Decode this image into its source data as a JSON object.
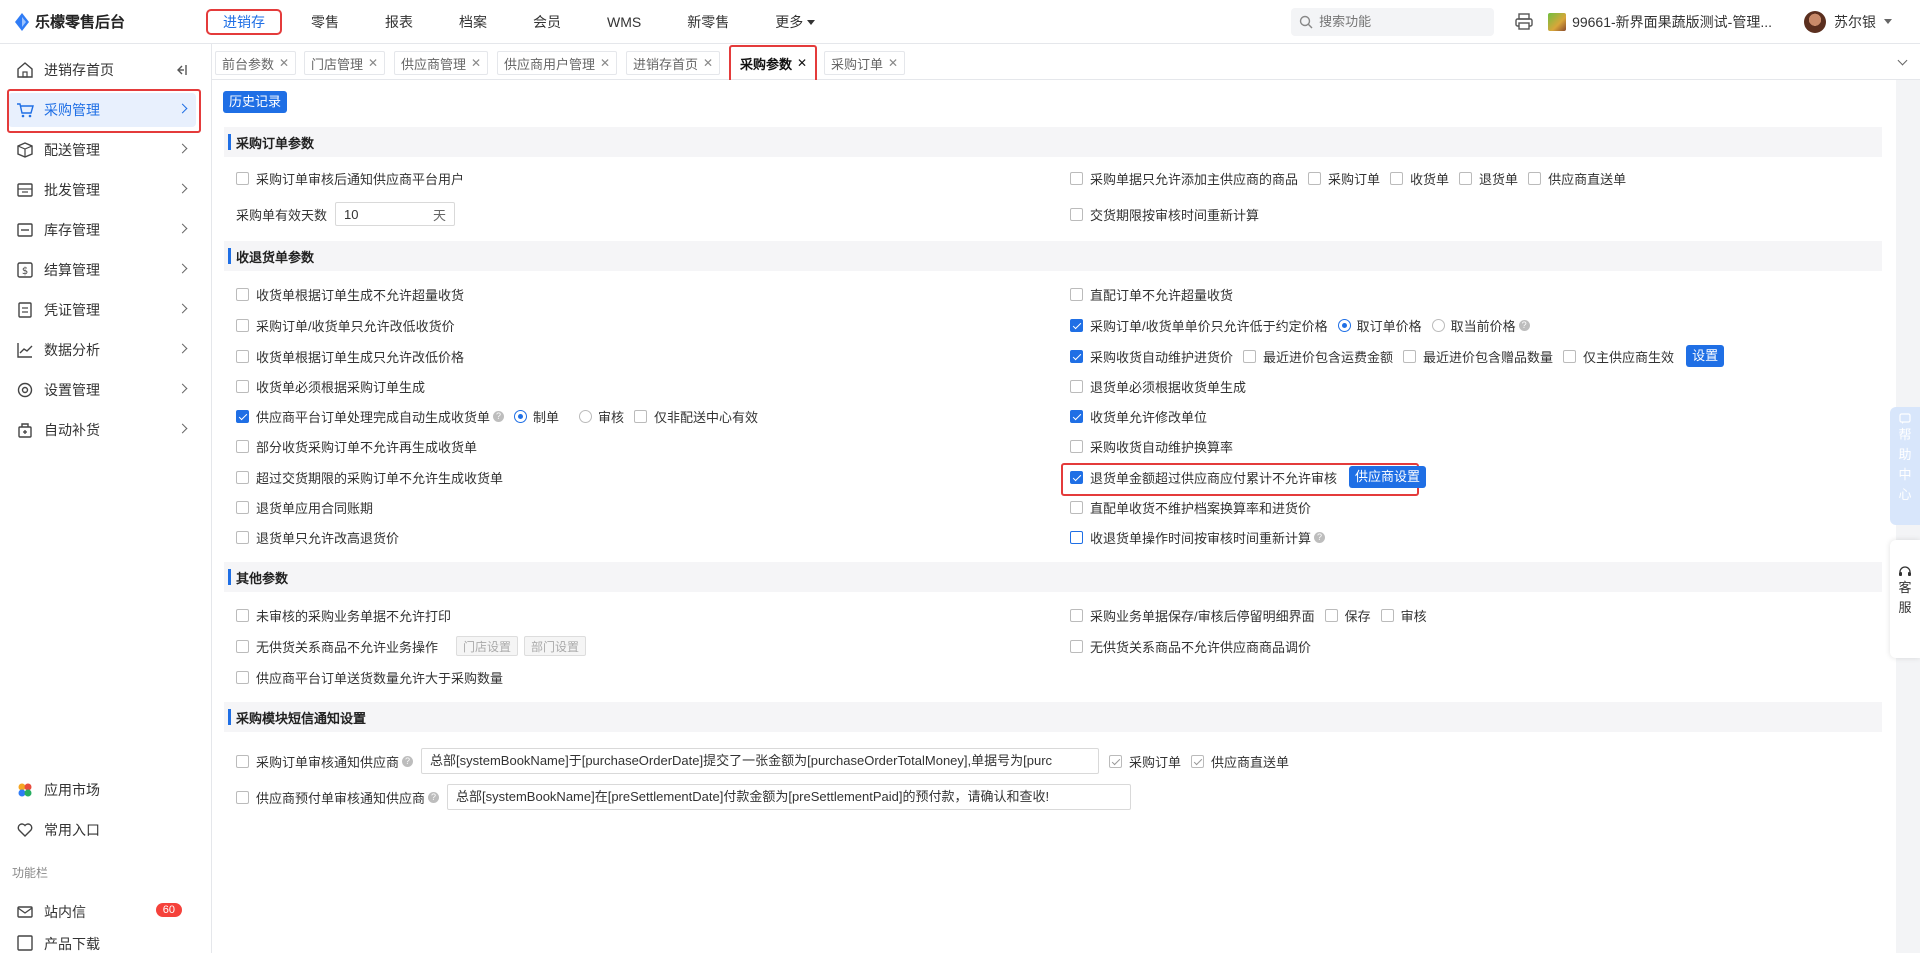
{
  "app": {
    "brand": "乐檬零售后台"
  },
  "topnav": {
    "items": [
      "进销存",
      "零售",
      "报表",
      "档案",
      "会员",
      "WMS",
      "新零售",
      "更多"
    ],
    "search_placeholder": "搜索功能",
    "store": "99661-新界面果蔬版测试-管理...",
    "user": "苏尔银"
  },
  "sidebar": {
    "items": [
      "进销存首页",
      "采购管理",
      "配送管理",
      "批发管理",
      "库存管理",
      "结算管理",
      "凭证管理",
      "数据分析",
      "设置管理",
      "自动补货"
    ],
    "bottom": {
      "market": "应用市场",
      "common": "常用入口",
      "group_label": "功能栏",
      "inbox": "站内信",
      "inbox_count": "60",
      "download": "产品下载"
    }
  },
  "tabs": [
    "前台参数",
    "门店管理",
    "供应商管理",
    "供应商用户管理",
    "进销存首页",
    "采购参数",
    "采购订单"
  ],
  "toolbar": {
    "history": "历史记录"
  },
  "sections": {
    "order": {
      "title": "采购订单参数",
      "notify_supplier": "采购订单审核后通知供应商平台用户",
      "valid_days_label": "采购单有效天数",
      "valid_days_value": "10",
      "valid_days_unit": "天",
      "main_supplier_only": "采购单据只允许添加主供应商的商品",
      "opt_order": "采购订单",
      "opt_receipt": "收货单",
      "opt_return": "退货单",
      "opt_direct": "供应商直送单",
      "recalc_delivery": "交货期限按审核时间重新计算"
    },
    "receipt": {
      "title": "收退货单参数",
      "left": [
        "收货单根据订单生成不允许超量收货",
        "采购订单/收货单只允许改低收货价",
        "收货单根据订单生成只允许改低价格",
        "收货单必须根据采购订单生成",
        "供应商平台订单处理完成自动生成收货单",
        "部分收货采购订单不允许再生成收货单",
        "超过交货期限的采购订单不允许生成收货单",
        "退货单应用合同账期",
        "退货单只允许改高退货价"
      ],
      "auto_opts": {
        "make": "制单",
        "audit": "审核",
        "non_dc": "仅非配送中心有效"
      },
      "right": {
        "direct_no_over": "直配订单不允许超量收货",
        "price_limit": "采购订单/收货单单价只允许低于约定价格",
        "take_order_price": "取订单价格",
        "take_current_price": "取当前价格",
        "auto_cost": "采购收货自动维护进货价",
        "inc_freight": "最近进价包含运费金额",
        "inc_gift": "最近进价包含赠品数量",
        "main_only": "仅主供应商生效",
        "setup_btn": "设置",
        "return_from_receipt": "退货单必须根据收货单生成",
        "allow_unit": "收货单允许修改单位",
        "auto_rate": "采购收货自动维护换算率",
        "return_exceed": "退货单金额超过供应商应付累计不允许审核",
        "supplier_setup_btn": "供应商设置",
        "direct_no_maintain": "直配单收货不维护档案换算率和进货价",
        "recalc_audit_time": "收退货单操作时间按审核时间重新计算"
      }
    },
    "other": {
      "title": "其他参数",
      "no_print": "未审核的采购业务单据不允许打印",
      "no_supply_op": "无供货关系商品不允许业务操作",
      "store_setup": "门店设置",
      "dept_setup": "部门设置",
      "platform_qty": "供应商平台订单送货数量允许大于采购数量",
      "stay_detail": "采购业务单据保存/审核后停留明细界面",
      "opt_save": "保存",
      "opt_audit": "审核",
      "no_adjust_price": "无供货关系商品不允许供应商商品调价"
    },
    "sms": {
      "title": "采购模块短信通知设置",
      "order_notify": "采购订单审核通知供应商",
      "order_template": "总部[systemBookName]于[purchaseOrderDate]提交了一张金额为[purchaseOrderTotalMoney],单据号为[purc",
      "opt_order": "采购订单",
      "opt_direct": "供应商直送单",
      "prepay_notify": "供应商预付单审核通知供应商",
      "prepay_template": "总部[systemBookName]在[preSettlementDate]付款金额为[preSettlementPaid]的预付款，请确认和查收!"
    }
  },
  "float": {
    "help": [
      "帮",
      "助",
      "中",
      "心"
    ],
    "service": [
      "客",
      "服"
    ]
  },
  "colors": {
    "accent": "#1f6fe5",
    "highlight": "#e43b3b"
  }
}
